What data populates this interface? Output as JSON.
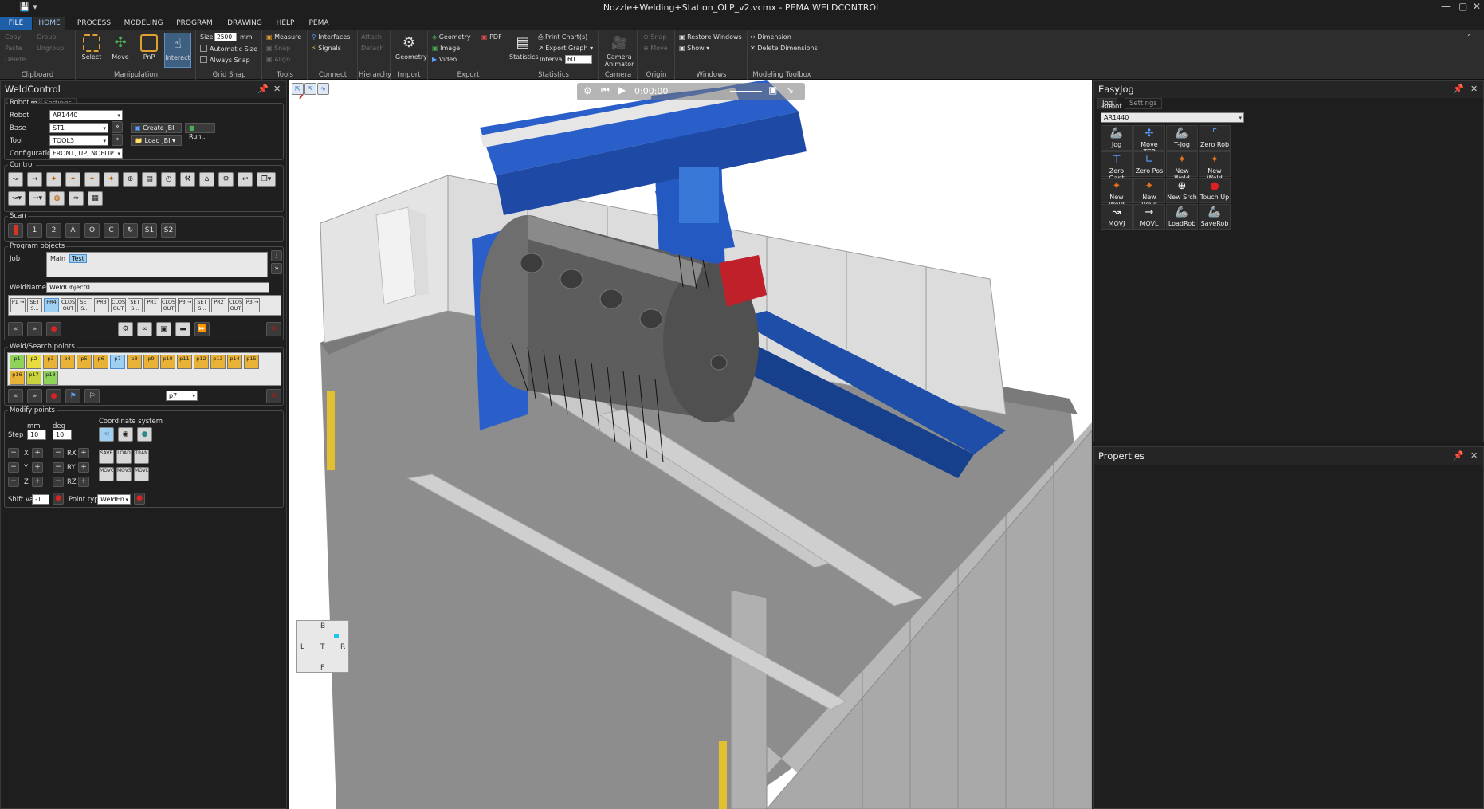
{
  "window": {
    "title": "Nozzle+Welding+Station_OLP_v2.vcmx - PEMA WELDCONTROL"
  },
  "menu_tabs": [
    "FILE",
    "HOME",
    "PROCESS",
    "MODELING",
    "PROGRAM",
    "DRAWING",
    "HELP",
    "PEMA"
  ],
  "ribbon": {
    "clipboard": {
      "label": "Clipboard",
      "items": [
        "Copy",
        "Paste",
        "Delete",
        "Group",
        "Ungroup"
      ]
    },
    "manipulation": {
      "label": "Manipulation",
      "buttons": [
        "Select",
        "Move",
        "PnP",
        "Interact"
      ]
    },
    "grid_snap": {
      "label": "Grid Snap",
      "size_label": "Size",
      "size_value": "2500",
      "size_unit": "mm",
      "automatic_size": "Automatic Size",
      "always_snap": "Always Snap"
    },
    "tools": {
      "label": "Tools",
      "items": [
        "Measure",
        "Snap",
        "Align"
      ]
    },
    "connect": {
      "label": "Connect",
      "items": [
        "Interfaces",
        "Signals"
      ]
    },
    "hierarchy": {
      "label": "Hierarchy",
      "items": [
        "Attach",
        "Detach"
      ]
    },
    "import": {
      "label": "Import",
      "button": "Geometry"
    },
    "export": {
      "label": "Export",
      "items": [
        "Geometry",
        "PDF",
        "Image",
        "Video"
      ]
    },
    "statistics": {
      "label": "Statistics",
      "button": "Statistics",
      "print": "Print Chart(s)",
      "export_graph": "Export Graph",
      "interval_label": "Interval",
      "interval_value": "60"
    },
    "camera": {
      "label": "Camera",
      "button": "Camera Animator"
    },
    "origin": {
      "label": "Origin",
      "items": [
        "Snap",
        "Move"
      ]
    },
    "windows": {
      "label": "Windows",
      "items": [
        "Restore Windows",
        "Show"
      ]
    },
    "modeling_toolbox": {
      "label": "Modeling Toolbox",
      "items": [
        "Dimension",
        "Delete Dimensions"
      ]
    }
  },
  "weldcontrol": {
    "title": "WeldControl",
    "tabs": [
      "Program",
      "Settings"
    ],
    "robot": {
      "section": "Robot",
      "robot_label": "Robot",
      "robot_value": "AR1440",
      "base_label": "Base",
      "base_value": "ST1",
      "tool_label": "Tool",
      "tool_value": "TOOL3",
      "config_label": "Configuration",
      "config_value": "FRONT, UP, NOFLIP",
      "create_jbi": "Create JBI",
      "load_jbi": "Load JBI",
      "run": "Run..."
    },
    "control": {
      "section": "Control"
    },
    "scan": {
      "section": "Scan",
      "buttons": [
        "1",
        "2",
        "A",
        "O",
        "C",
        "↻",
        "S1",
        "S2"
      ]
    },
    "program_objects": {
      "section": "Program objects",
      "job_label": "Job",
      "jobs": [
        "Main",
        "Test"
      ],
      "weldname_label": "WeldName",
      "weldname_value": "WeldObject0",
      "instructions": [
        "P1 →",
        "SET S...",
        "PR4",
        "CLOS OUT",
        "SET S...",
        "PR3",
        "CLOS OUT",
        "SET S...",
        "PR1",
        "CLOS OUT",
        "P3 →",
        "SET S...",
        "PR2",
        "CLOS OUT",
        "P3 →"
      ]
    },
    "weld_search": {
      "section": "Weld/Search points",
      "points": [
        "p1",
        "p2",
        "p3",
        "p4",
        "p5",
        "p6",
        "p7",
        "p8",
        "p9",
        "p10",
        "p11",
        "p12",
        "p13",
        "p14",
        "p15",
        "p16",
        "p17",
        "p18"
      ],
      "selected": "p7"
    },
    "modify": {
      "section": "Modify points",
      "coord_label": "Coordinate system",
      "step_label": "Step",
      "mm_label": "mm",
      "deg_label": "deg",
      "mm_value": "10",
      "deg_value": "10",
      "axes": [
        "X",
        "Y",
        "Z",
        "RX",
        "RY",
        "RZ"
      ],
      "shift_label": "Shift var",
      "shift_value": "-1",
      "point_type_label": "Point type",
      "point_type_value": "WeldEn"
    }
  },
  "easyjog": {
    "title": "EasyJog",
    "tabs": [
      "Jog",
      "Settings"
    ],
    "robot_label": "Robot",
    "robot_value": "AR1440",
    "buttons": [
      "Jog",
      "Move TCP",
      "T-Jog",
      "Zero Rob",
      "Zero Gant",
      "Zero Pos",
      "New Weld",
      "New Weld",
      "New Weld",
      "New Weld",
      "New Srch",
      "Touch Up",
      "MOVJ",
      "MOVL",
      "LoadRob",
      "SaveRob"
    ]
  },
  "properties": {
    "title": "Properties"
  },
  "viewport": {
    "sim_time": "0:00:00",
    "cube": {
      "top": "B",
      "left": "L",
      "center": "T",
      "right": "R",
      "bottom": "F"
    }
  }
}
